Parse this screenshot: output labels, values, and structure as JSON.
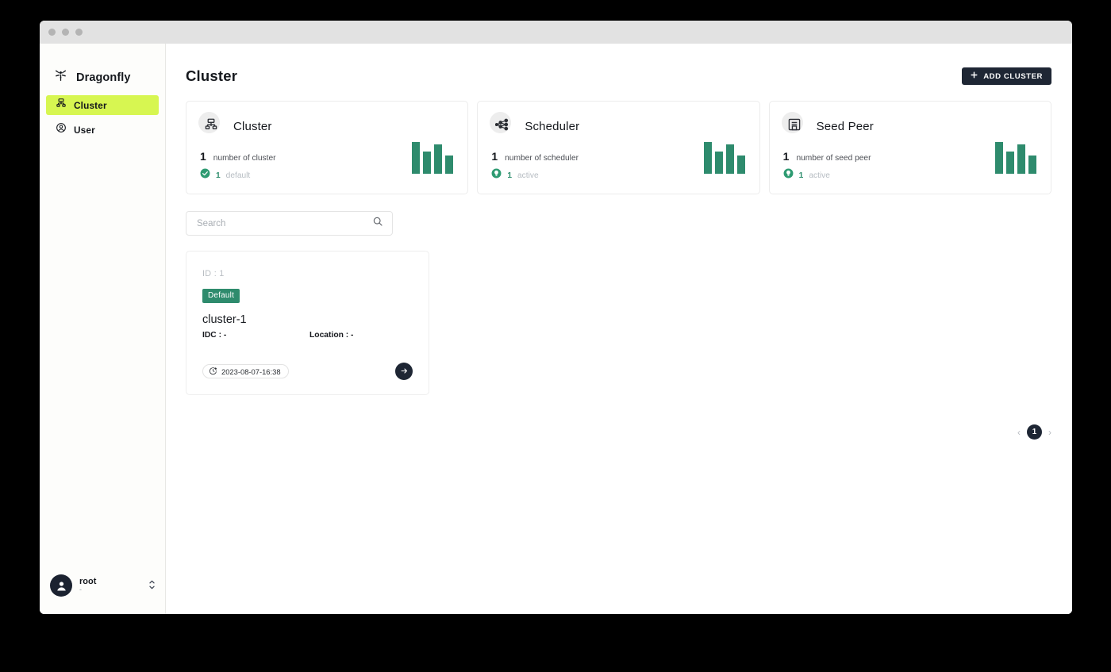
{
  "window": {
    "titlebar_dots": [
      "close",
      "minimize",
      "maximize"
    ]
  },
  "sidebar": {
    "brand": "Dragonfly",
    "items": [
      {
        "label": "Cluster",
        "icon": "cluster-icon",
        "active": true
      },
      {
        "label": "User",
        "icon": "user-icon",
        "active": false
      }
    ],
    "footer": {
      "user_name": "root",
      "user_sub": "-"
    }
  },
  "header": {
    "title": "Cluster",
    "add_button": "ADD CLUSTER",
    "add_button_icon": "plus-icon",
    "add_button_color": "#1e2634"
  },
  "stat_cards": [
    {
      "title": "Cluster",
      "icon": "cluster-icon",
      "number": "1",
      "label": "number of cluster",
      "sub_number": "1",
      "sub_text": "default",
      "sub_icon": "check-circle-icon"
    },
    {
      "title": "Scheduler",
      "icon": "scheduler-icon",
      "number": "1",
      "label": "number of scheduler",
      "sub_number": "1",
      "sub_text": "active",
      "sub_icon": "status-active-icon"
    },
    {
      "title": "Seed Peer",
      "icon": "seed-peer-icon",
      "number": "1",
      "label": "number of seed peer",
      "sub_number": "1",
      "sub_text": "active",
      "sub_icon": "status-active-icon"
    }
  ],
  "search": {
    "value": "",
    "placeholder": "Search",
    "icon": "search-icon"
  },
  "cluster_card": {
    "id_label": "ID : 1",
    "badge": "Default",
    "name": "cluster-1",
    "idc": "IDC : -",
    "location": "Location : -",
    "timestamp": "2023-08-07-16:38",
    "timestamp_icon": "clock-plus-icon",
    "go_icon": "arrow-right-icon"
  },
  "pagination": {
    "prev": "‹",
    "next": "›",
    "current": "1"
  },
  "colors": {
    "accent_lime": "#d7f651",
    "dark_navy": "#1e2634",
    "green": "#2e8b6d",
    "muted": "#b6bcc2"
  },
  "chart_data": [
    {
      "type": "bar",
      "title": "Cluster sparkline",
      "categories": [
        "1",
        "2",
        "3",
        "4"
      ],
      "values": [
        40,
        28,
        37,
        23
      ],
      "ylim": [
        0,
        44
      ],
      "xlabel": "",
      "ylabel": ""
    },
    {
      "type": "bar",
      "title": "Scheduler sparkline",
      "categories": [
        "1",
        "2",
        "3",
        "4"
      ],
      "values": [
        40,
        28,
        37,
        23
      ],
      "ylim": [
        0,
        44
      ],
      "xlabel": "",
      "ylabel": ""
    },
    {
      "type": "bar",
      "title": "Seed Peer sparkline",
      "categories": [
        "1",
        "2",
        "3",
        "4"
      ],
      "values": [
        40,
        28,
        37,
        23
      ],
      "ylim": [
        0,
        44
      ],
      "xlabel": "",
      "ylabel": ""
    }
  ]
}
